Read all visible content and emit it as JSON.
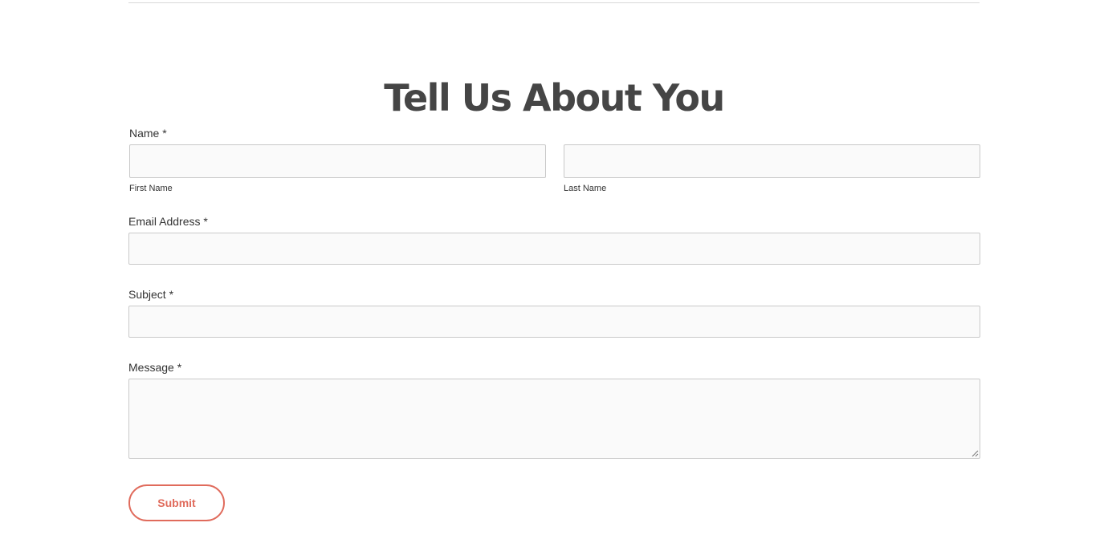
{
  "heading": "Tell Us About You",
  "form": {
    "name": {
      "label": "Name *",
      "first": {
        "sublabel": "First Name",
        "value": "",
        "placeholder": ""
      },
      "last": {
        "sublabel": "Last Name",
        "value": "",
        "placeholder": ""
      }
    },
    "email": {
      "label": "Email Address *",
      "value": "",
      "placeholder": ""
    },
    "subject": {
      "label": "Subject *",
      "value": "",
      "placeholder": ""
    },
    "message": {
      "label": "Message *",
      "value": "",
      "placeholder": ""
    },
    "submit_label": "Submit"
  },
  "colors": {
    "accent": "#e06b5c",
    "heading": "#454545",
    "field_background": "#fafafa",
    "field_border": "#c9c9c9"
  }
}
